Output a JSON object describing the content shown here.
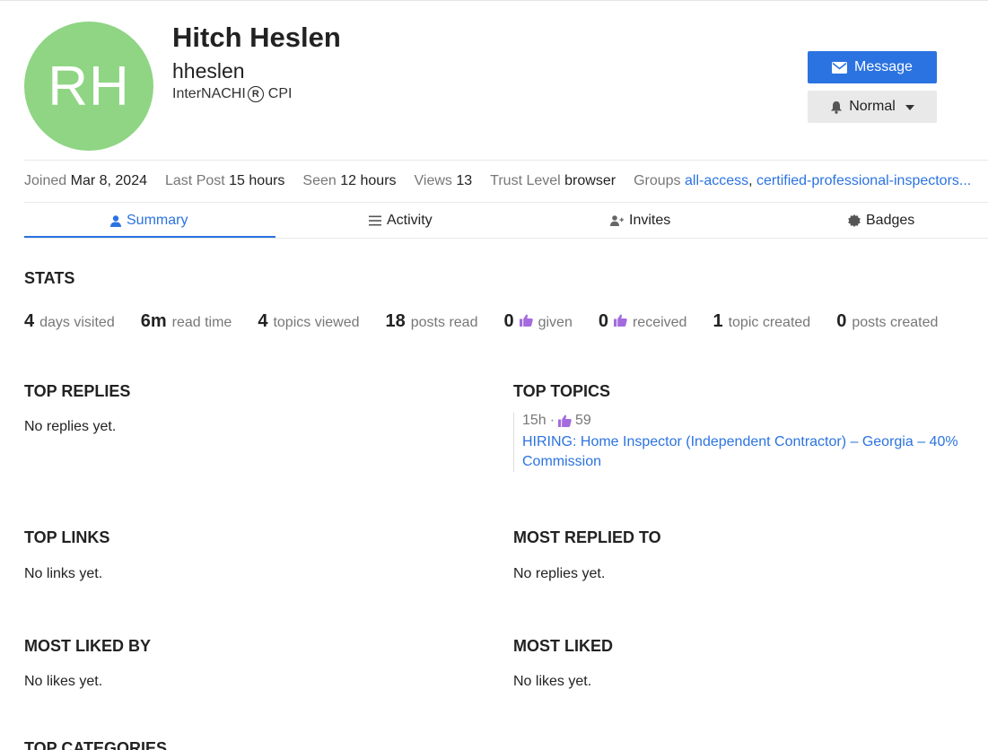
{
  "profile": {
    "initials": "RH",
    "name": "Hitch Heslen",
    "username": "hheslen",
    "title_prefix": "InterNACHI",
    "title_suffix": "CPI"
  },
  "actions": {
    "message_label": "Message",
    "notification_label": "Normal"
  },
  "meta": {
    "joined_label": "Joined",
    "joined_value": "Mar 8, 2024",
    "last_post_label": "Last Post",
    "last_post_value": "15 hours",
    "seen_label": "Seen",
    "seen_value": "12 hours",
    "views_label": "Views",
    "views_value": "13",
    "trust_label": "Trust Level",
    "trust_value": "browser",
    "groups_label": "Groups",
    "group_1": "all-access",
    "group_sep": ",",
    "group_2": "certified-professional-inspectors..."
  },
  "tabs": [
    {
      "label": "Summary",
      "icon": "user-icon",
      "active": true
    },
    {
      "label": "Activity",
      "icon": "list-icon",
      "active": false
    },
    {
      "label": "Invites",
      "icon": "user-plus-icon",
      "active": false
    },
    {
      "label": "Badges",
      "icon": "badge-icon",
      "active": false
    }
  ],
  "stats": {
    "heading": "STATS",
    "items": [
      {
        "value": "4",
        "label": "days visited"
      },
      {
        "value": "6m",
        "label": "read time"
      },
      {
        "value": "4",
        "label": "topics viewed"
      },
      {
        "value": "18",
        "label": "posts read"
      },
      {
        "value": "0",
        "label": "given",
        "icon": "thumbs-up-icon"
      },
      {
        "value": "0",
        "label": "received",
        "icon": "thumbs-up-icon"
      },
      {
        "value": "1",
        "label": "topic created"
      },
      {
        "value": "0",
        "label": "posts created"
      }
    ]
  },
  "sections": {
    "top_replies": {
      "heading": "TOP REPLIES",
      "empty": "No replies yet."
    },
    "top_topics": {
      "heading": "TOP TOPICS",
      "topic_age": "15h",
      "topic_sep": "·",
      "topic_likes": "59",
      "topic_title": "HIRING: Home Inspector (Independent Contractor) – Georgia – 40% Commission"
    },
    "top_links": {
      "heading": "TOP LINKS",
      "empty": "No links yet."
    },
    "most_replied_to": {
      "heading": "MOST REPLIED TO",
      "empty": "No replies yet."
    },
    "most_liked_by": {
      "heading": "MOST LIKED BY",
      "empty": "No likes yet."
    },
    "most_liked": {
      "heading": "MOST LIKED",
      "empty": "No likes yet."
    },
    "top_categories": {
      "heading": "TOP CATEGORIES"
    }
  },
  "colors": {
    "accent": "#2b73e0",
    "avatar_bg": "#8fd584",
    "like_purple": "#a46bde",
    "muted_text": "#777777"
  }
}
